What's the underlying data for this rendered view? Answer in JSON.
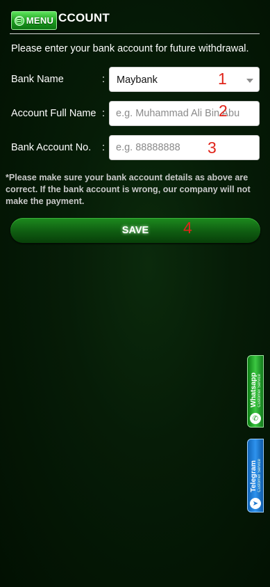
{
  "header": {
    "menu_label": "MENU",
    "title": "CCOUNT"
  },
  "intro": "Please enter your bank account for future withdrawal.",
  "form": {
    "bank_name": {
      "label": "Bank Name",
      "colon": ":",
      "value": "Maybank",
      "marker": "1"
    },
    "full_name": {
      "label": "Account Full Name",
      "colon": ":",
      "value": "",
      "placeholder": "e.g. Muhammad Ali Bin Abu",
      "marker": "2"
    },
    "account_no": {
      "label": "Bank Account No.",
      "colon": ":",
      "value": "",
      "placeholder": "e.g. 88888888",
      "marker": "3"
    }
  },
  "note": "*Please make sure your bank account details as above are correct. If the bank account is wrong, our company will not make the payment.",
  "save": {
    "label": "SAVE",
    "marker": "4"
  },
  "side_tabs": {
    "whatsapp": {
      "label": "Whatsapp",
      "sub": "Customer Service",
      "icon": "whatsapp-icon"
    },
    "telegram": {
      "label": "Telegram",
      "sub": "Customer Service",
      "icon": "telegram-icon"
    }
  },
  "colors": {
    "accent": "#1d8b1e",
    "background": "#021402",
    "marker": "#e0241a"
  }
}
